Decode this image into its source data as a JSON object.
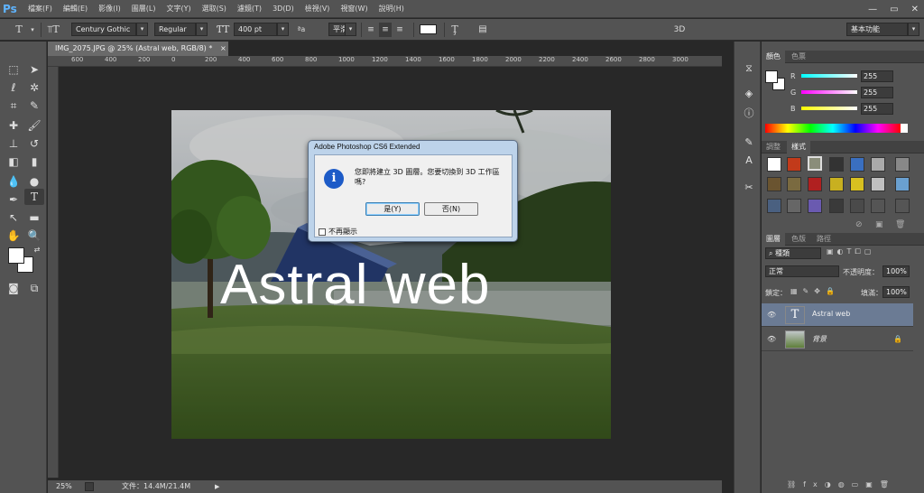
{
  "app": {
    "logo": "Ps"
  },
  "menu": [
    "檔案(F)",
    "編輯(E)",
    "影像(I)",
    "圖層(L)",
    "文字(Y)",
    "選取(S)",
    "濾鏡(T)",
    "3D(D)",
    "檢視(V)",
    "視窗(W)",
    "說明(H)"
  ],
  "window_controls": {
    "minimize": "—",
    "restore": "▭",
    "close": "✕"
  },
  "options": {
    "font_family": "Century Gothic",
    "font_style": "Regular",
    "font_size": "400 pt",
    "aa_label": "ªa",
    "antialias": "平滑",
    "mode_3d": "3D",
    "workspace": "基本功能"
  },
  "document": {
    "tab_title": "IMG_2075.JPG @ 25% (Astral web, RGB/8) *",
    "ruler_ticks": [
      "600",
      "400",
      "200",
      "0",
      "200",
      "400",
      "600",
      "800",
      "1000",
      "1200",
      "1400",
      "1600",
      "1800",
      "2000",
      "2200",
      "2400",
      "2600",
      "2800",
      "3000"
    ],
    "overlay_text": "Astral web",
    "zoom": "25%",
    "file_info": "文件：14.4M/21.4M"
  },
  "dialog": {
    "title": "Adobe Photoshop CS6 Extended",
    "message": "您即將建立 3D 圖層。您要切換到 3D 工作區嗎?",
    "yes_label": "是(Y)",
    "no_label": "否(N)",
    "checkbox_label": "不再顯示",
    "info_glyph": "i"
  },
  "color_panel": {
    "tabs": [
      "顏色",
      "色票"
    ],
    "channels": [
      {
        "name": "R",
        "value": "255",
        "color": "#ff3030"
      },
      {
        "name": "G",
        "value": "255",
        "color": "#30ff30"
      },
      {
        "name": "B",
        "value": "255",
        "color": "#3030ff"
      }
    ]
  },
  "styles_panel": {
    "tabs": [
      "調整",
      "樣式"
    ]
  },
  "layers_panel": {
    "tabs": [
      "圖層",
      "色版",
      "路徑"
    ],
    "kind_filter": "種類",
    "blend_mode": "正常",
    "opacity_label": "不透明度：",
    "opacity_value": "100%",
    "lock_label": "鎖定：",
    "fill_label": "填滿：",
    "fill_value": "100%",
    "layers": [
      {
        "name": "Astral web",
        "type": "text"
      },
      {
        "name": "背景",
        "type": "image"
      }
    ]
  }
}
